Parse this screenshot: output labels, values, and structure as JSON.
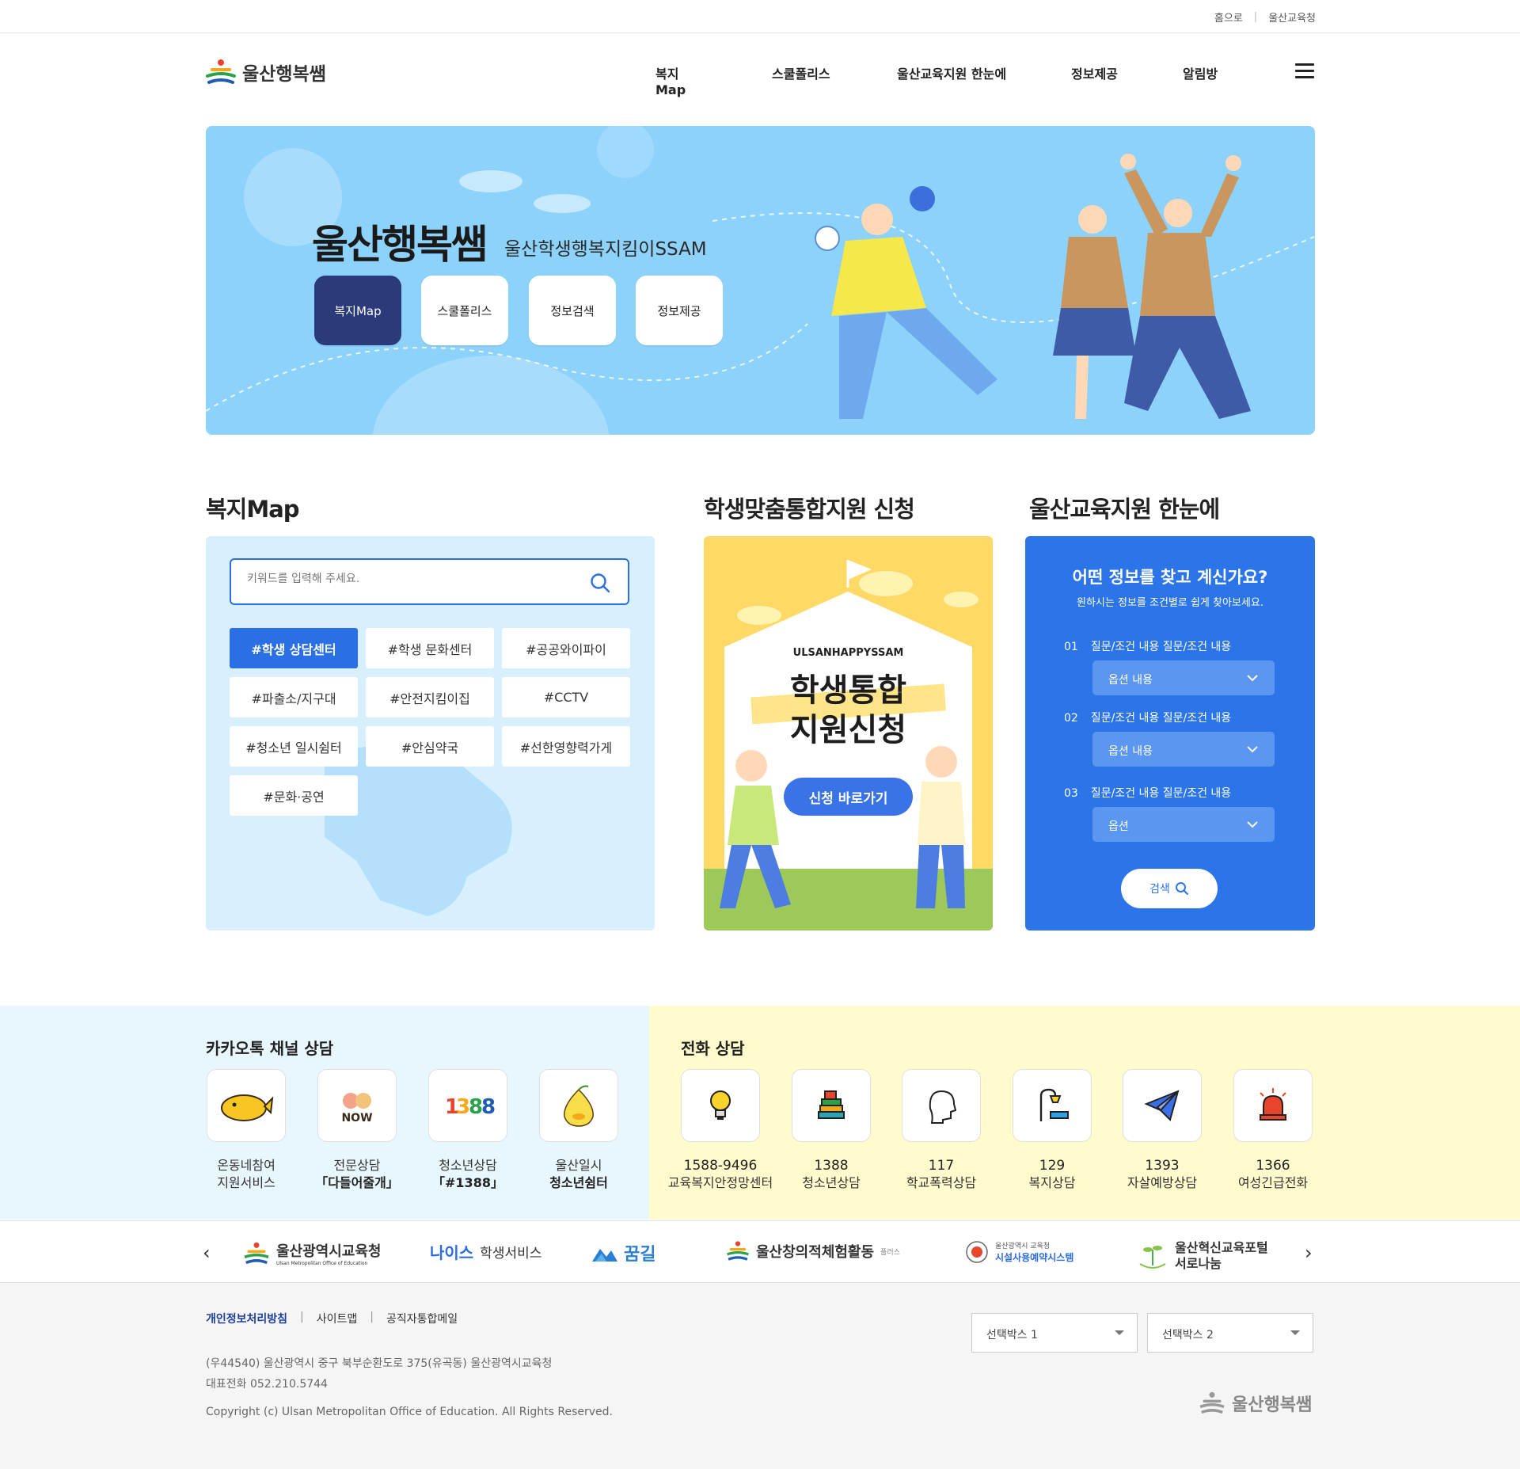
{
  "util": {
    "home": "홈으로",
    "office": "울산교육청"
  },
  "header": {
    "logo": "울산행복쌤",
    "nav": [
      "복지Map",
      "스쿨폴리스",
      "울산교육지원 한눈에",
      "정보제공",
      "알림방"
    ]
  },
  "hero": {
    "title": "울산행복쌤",
    "subtitle": "울산학생행복지킴이SSAM",
    "buttons": [
      "복지Map",
      "스쿨폴리스",
      "정보검색",
      "정보제공"
    ],
    "bg_color": "#8dd2fb",
    "active_color": "#2b3a7a"
  },
  "map": {
    "title": "복지Map",
    "search_placeholder": "키워드를 입력해 주세요.",
    "tags": [
      "#학생 상담센터",
      "#학생 문화센터",
      "#공공와이파이",
      "#파출소/지구대",
      "#안전지킴이집",
      "#CCTV",
      "#청소년 일시쉼터",
      "#안심약국",
      "#선한영향력가게",
      "#문화·공연"
    ]
  },
  "apply": {
    "title": "학생맞춤통합지원 신청",
    "eng": "ULSANHAPPYSSAM",
    "line1": "학생통합",
    "line2": "지원신청",
    "cta": "신청 바로가기"
  },
  "finder": {
    "title": "울산교육지원 한눈에",
    "question": "어떤 정보를 찾고 계신가요?",
    "hint": "원하시는 정보를 조건별로 쉽게 찾아보세요.",
    "rows": [
      {
        "no": "01",
        "label": "질문/조건 내용 질문/조건 내용",
        "option": "옵션 내용"
      },
      {
        "no": "02",
        "label": "질문/조건 내용 질문/조건 내용",
        "option": "옵션 내용"
      },
      {
        "no": "03",
        "label": "질문/조건 내용 질문/조건 내용",
        "option": "옵션"
      }
    ],
    "button": "검색",
    "accent": "#2b75e8"
  },
  "kakao": {
    "title": "카카오톡 채널 상담",
    "items": [
      {
        "line1": "온동네참여",
        "line2": "지원서비스",
        "icon": "whale-icon"
      },
      {
        "line1": "전문상담",
        "line2": "「다들어줄개」",
        "icon": "now-logo-icon"
      },
      {
        "line1": "청소년상담",
        "line2": "「#1388」",
        "icon": "1388-logo-icon"
      },
      {
        "line1": "울산일시",
        "line2": "청소년쉼터",
        "icon": "pear-character-icon"
      }
    ]
  },
  "phone": {
    "title": "전화 상담",
    "items": [
      {
        "num": "1588-9496",
        "label": "교육복지안정망센터",
        "icon": "lightbulb-icon"
      },
      {
        "num": "1388",
        "label": "청소년상담",
        "icon": "books-icon"
      },
      {
        "num": "117",
        "label": "학교폭력상담",
        "icon": "head-icon"
      },
      {
        "num": "129",
        "label": "복지상담",
        "icon": "lamp-bed-icon"
      },
      {
        "num": "1393",
        "label": "자살예방상담",
        "icon": "paper-plane-icon"
      },
      {
        "num": "1366",
        "label": "여성긴급전화",
        "icon": "siren-icon"
      }
    ]
  },
  "partners": {
    "p1": "울산광역시교육청",
    "p1_sub": "Ulsan Metropolitan Office of Education",
    "p2a": "나이스",
    "p2b": "학생서비스",
    "p3": "꿈길",
    "p4": "울산창의적체험활동",
    "p4_sub": "플러스",
    "p5_top": "울산광역시 교육청",
    "p5": "시설사용예약시스템",
    "p6_line1": "울산혁신교육포털",
    "p6_line2": "서로나눔"
  },
  "footer": {
    "links": [
      "개인정보처리방침",
      "사이트맵",
      "공직자통합메일"
    ],
    "select1": "선택박스 1",
    "select2": "선택박스 2",
    "address": "(우44540) 울산광역시 중구 북부순환도로 375(유곡동) 울산광역시교육청",
    "tel": "대표전화 052.210.5744",
    "copyright": "Copyright (c) Ulsan Metropolitan Office of Education. All Rights Reserved.",
    "logo": "울산행복쌤"
  }
}
